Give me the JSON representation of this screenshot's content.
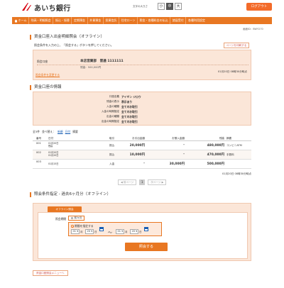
{
  "header": {
    "bank_name": "あいち銀行",
    "font_size_label": "文字の大きさ",
    "font_sizes": [
      "小",
      "中",
      "大"
    ],
    "logout_label": "ログアウト",
    "accent": "#e87722"
  },
  "nav": {
    "items": [
      "ホーム",
      "残高・明細照会",
      "振込・振替",
      "定期預金",
      "外貨預金",
      "投資信託",
      "住宅ローン",
      "税金・各種料金の払込",
      "諸届受付",
      "各種利用設定"
    ]
  },
  "screen_id": "画面ID：BWY270",
  "section1": {
    "title": "資金口座入出金明細照会（オフライン）",
    "desc": "照会条件を入力の上、「照会する」ボタンを押してください。",
    "print_label": "ページを印刷する"
  },
  "account": {
    "label": "照会口座",
    "value": "本店営業部　普通 1111111",
    "balance": "残高：500,000円",
    "asof": "01月20日 08時30分時点",
    "change_link": "照会条件を変更する"
  },
  "conditions": {
    "title": "資金口座の情報",
    "rows": [
      {
        "label": "口座名義",
        "value": "アイギン ジロウ"
      },
      {
        "label": "残高の表示",
        "value": "表示あり"
      },
      {
        "label": "入金の種類",
        "value": "全てのお取引"
      },
      {
        "label": "入金の時期指定",
        "value": "全てのお取引"
      },
      {
        "label": "出金の種類",
        "value": "全てのお取引"
      },
      {
        "label": "出金の時期指定",
        "value": "全てのお取引"
      }
    ]
  },
  "tools": {
    "count": "全3件",
    "sort_label": "並べ替え：",
    "sort_asc": "新順",
    "sort_desc": "日付",
    "filter_label": "摘要"
  },
  "table": {
    "headers": [
      "番号",
      "日付",
      "取引",
      "お引出金額",
      "お預入金額",
      "残高",
      "摘要"
    ],
    "rows": [
      {
        "no": "001",
        "date": "01月20日\n残高",
        "kind": "振込",
        "out": "20,000円",
        "in": "-",
        "bal": "480,000円",
        "memo": "コンビニATM"
      },
      {
        "no": "002",
        "date": "01月20日\n01月20日",
        "kind": "振込",
        "out": "10,000円",
        "in": "-",
        "bal": "470,000円",
        "memo": "手数料"
      },
      {
        "no": "003",
        "date": "01月15日",
        "kind": "入金",
        "out": "-",
        "in": "30,000円",
        "bal": "500,000円",
        "memo": ""
      }
    ],
    "bottom_asof": "01月20日 08時30分時点"
  },
  "pager": {
    "prev": "前ページ",
    "current": "1",
    "next": "次ページ"
  },
  "section2": {
    "title": "照会条件指定 - 過去6ヶ月分（オフライン）",
    "tab": "オフライン照会",
    "period_label": "照会期間",
    "prev_option": "前々月",
    "range_option": "期間を指定する",
    "from_month": "01",
    "from_day": "20",
    "to_month": "01",
    "to_day": "20",
    "unit_month": "月",
    "unit_day": "日",
    "tilde": "〜",
    "submit": "照会する"
  },
  "footer": {
    "menu_link": "資金口座照会メニューへ"
  }
}
